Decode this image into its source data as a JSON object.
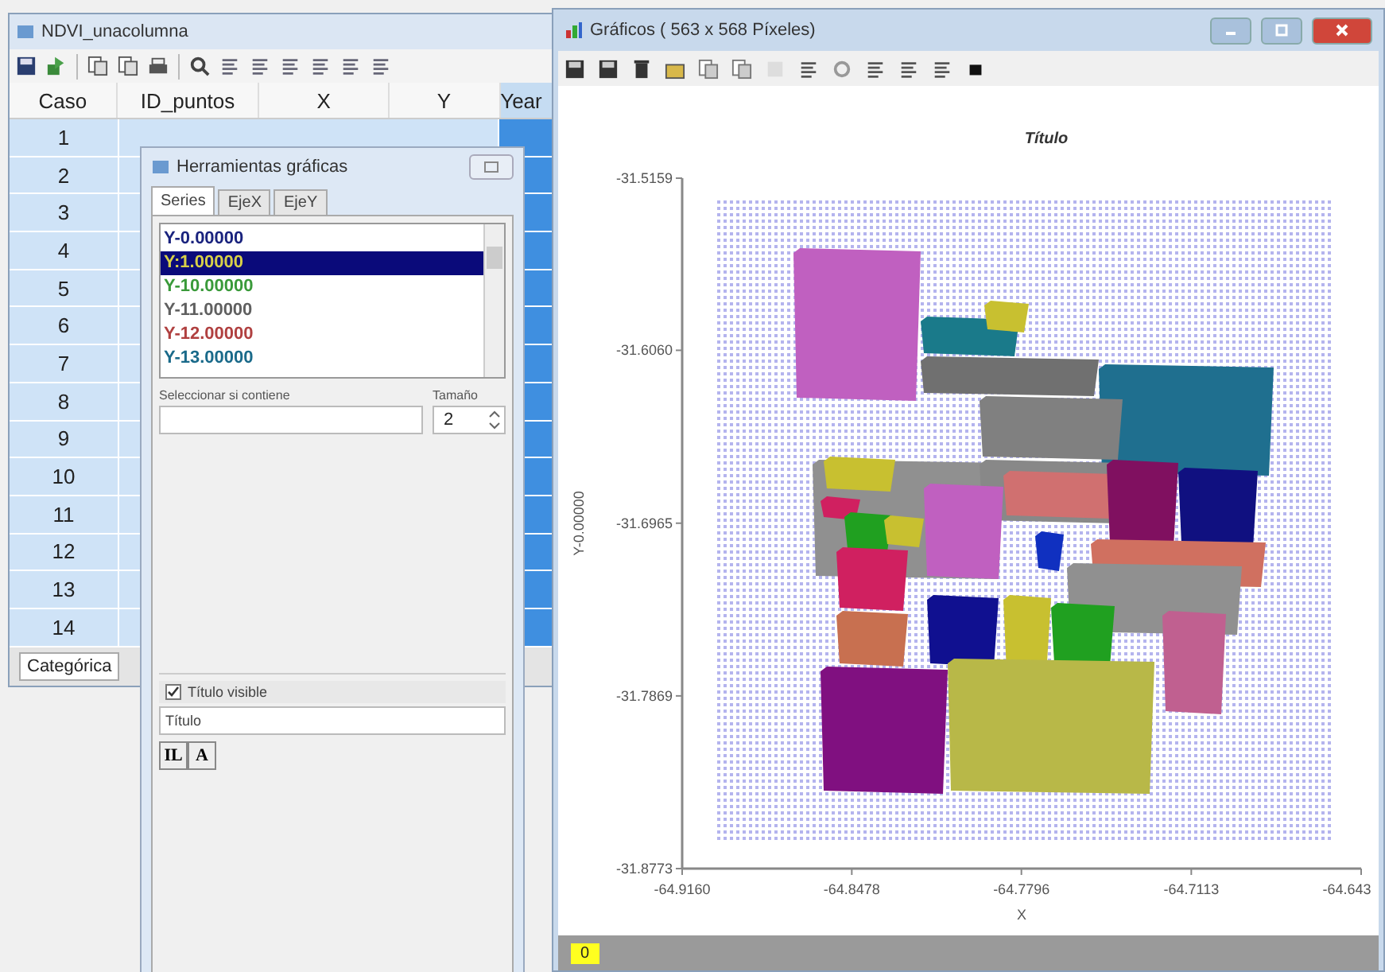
{
  "data_window": {
    "title": "NDVI_unacolumna",
    "columns": [
      "Caso",
      "ID_puntos",
      "X",
      "Y",
      "Year"
    ],
    "rows": [
      {
        "caso": "1"
      },
      {
        "caso": "2"
      },
      {
        "caso": "3"
      },
      {
        "caso": "4"
      },
      {
        "caso": "5"
      },
      {
        "caso": "6"
      },
      {
        "caso": "7"
      },
      {
        "caso": "8"
      },
      {
        "caso": "9"
      },
      {
        "caso": "10"
      },
      {
        "caso": "11"
      },
      {
        "caso": "12"
      },
      {
        "caso": "13"
      },
      {
        "caso": "14"
      }
    ],
    "sheet_tab": "Categórica"
  },
  "tools_dialog": {
    "title": "Herramientas gráficas",
    "tabs": [
      {
        "label": "Series",
        "selected": true
      },
      {
        "label": "EjeX",
        "selected": false
      },
      {
        "label": "EjeY",
        "selected": false
      }
    ],
    "series": [
      {
        "label": "Y-0.00000",
        "color": "#1a237e",
        "selected": false
      },
      {
        "label": "Y:1.00000",
        "color": "#d8d048",
        "selected": true
      },
      {
        "label": "Y-10.00000",
        "color": "#3a9a3a",
        "selected": false
      },
      {
        "label": "Y-11.00000",
        "color": "#606060",
        "selected": false
      },
      {
        "label": "Y-12.00000",
        "color": "#b04040",
        "selected": false
      },
      {
        "label": "Y-13.00000",
        "color": "#1a6a8a",
        "selected": false
      }
    ],
    "contains_label": "Seleccionar si contiene",
    "size_label": "Tamaño",
    "size_value": "2",
    "title_visible": {
      "label": "Título visible",
      "checked": true
    },
    "title_value": "Título",
    "format_buttons": [
      "IL",
      "A"
    ]
  },
  "chart_window": {
    "title": "Gráficos ( 563 x 568 Píxeles)",
    "chart_data": {
      "type": "scatter",
      "title": "Título",
      "xlabel": "X",
      "ylabel": "Y-0.00000",
      "xlim": [
        -64.916,
        -64.643
      ],
      "ylim": [
        -31.8773,
        -31.5159
      ],
      "xticks": [
        {
          "value": -64.916,
          "label": "-64.9160"
        },
        {
          "value": -64.8478,
          "label": "-64.8478"
        },
        {
          "value": -64.7796,
          "label": "-64.7796"
        },
        {
          "value": -64.7113,
          "label": "-64.7113"
        },
        {
          "value": -64.643,
          "label": "-64.643"
        }
      ],
      "yticks": [
        {
          "value": -31.5159,
          "label": "-31.5159"
        },
        {
          "value": -31.606,
          "label": "-31.6060"
        },
        {
          "value": -31.6965,
          "label": "-31.6965"
        },
        {
          "value": -31.7869,
          "label": "-31.7869"
        },
        {
          "value": -31.8773,
          "label": "-31.8773"
        }
      ]
    },
    "status": "0"
  }
}
